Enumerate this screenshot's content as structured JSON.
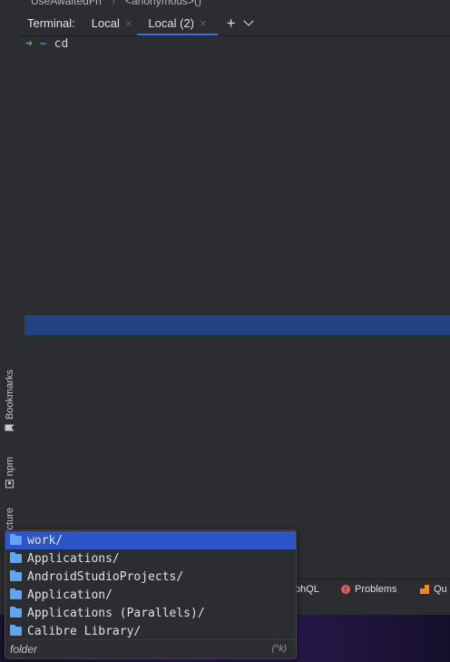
{
  "breadcrumb": {
    "function": "UseAwaitedFn",
    "separator": "›",
    "child": "<anonymous>()"
  },
  "sidebar": {
    "bookmarks_label": "Bookmarks",
    "npm_label": "npm",
    "structure_label": "cture"
  },
  "tabbar": {
    "title": "Terminal:",
    "tabs": [
      {
        "label": "Local",
        "active": false
      },
      {
        "label": "Local (2)",
        "active": true
      }
    ],
    "close_glyph": "×",
    "add_glyph": "+"
  },
  "terminal": {
    "prompt_arrow": "➜",
    "prompt_dir": "~",
    "command": "cd"
  },
  "bottom_bar": {
    "graphql_label": "phQL",
    "problems_label": "Problems",
    "problems_icon_glyph": "!",
    "queries_label": "Qu"
  },
  "completion_popup": {
    "items": [
      {
        "label": "work/",
        "selected": true
      },
      {
        "label": "Applications/",
        "selected": false
      },
      {
        "label": "AndroidStudioProjects/",
        "selected": false
      },
      {
        "label": "Application/",
        "selected": false
      },
      {
        "label": "Applications (Parallels)/",
        "selected": false
      },
      {
        "label": "Calibre Library/",
        "selected": false
      }
    ],
    "footer_hint": "folder",
    "footer_shortcut": "(^k)"
  },
  "colors": {
    "accent": "#3574f0",
    "selection": "#2e55c8",
    "selection_band": "#214283",
    "folder_icon": "#5ea5f5",
    "prompt_arrow": "#5fb857",
    "prompt_dir": "#44b9c8"
  }
}
